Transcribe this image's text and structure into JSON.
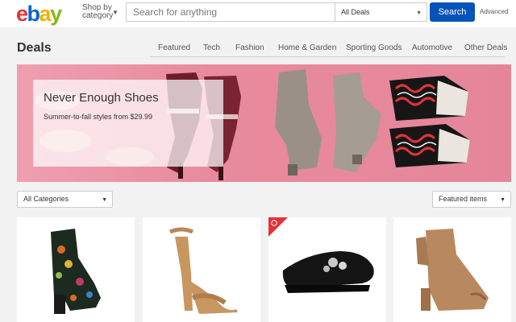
{
  "header": {
    "logo_letters": [
      "e",
      "b",
      "a",
      "y"
    ],
    "shop_by_line1": "Shop by",
    "shop_by_line2": "category",
    "search_placeholder": "Search for anything",
    "category_select": "All Deals",
    "search_button": "Search",
    "advanced_link": "Advanced"
  },
  "page_title": "Deals",
  "nav_tabs": [
    "Featured",
    "Tech",
    "Fashion",
    "Home & Garden",
    "Sporting Goods",
    "Automotive",
    "Other Deals"
  ],
  "banner": {
    "title": "Never Enough Shoes",
    "subtitle": "Summer-to-fall styles from $29.99"
  },
  "filters": {
    "category": "All Categories",
    "sort": "Featured items"
  },
  "products": [
    {
      "icon": "floral-ankle-boot-icon"
    },
    {
      "icon": "ankle-strap-heel-icon"
    },
    {
      "icon": "embellished-loafer-icon",
      "badge_icon": "clock-icon"
    },
    {
      "icon": "peep-toe-bootie-icon"
    }
  ],
  "colors": {
    "ebay_red": "#e53238",
    "ebay_blue": "#0064d2",
    "ebay_yellow": "#f5af02",
    "ebay_green": "#86b817",
    "search_button": "#0654ba",
    "banner_pink": "#e88a9d",
    "deal_badge_red": "#e53238"
  }
}
